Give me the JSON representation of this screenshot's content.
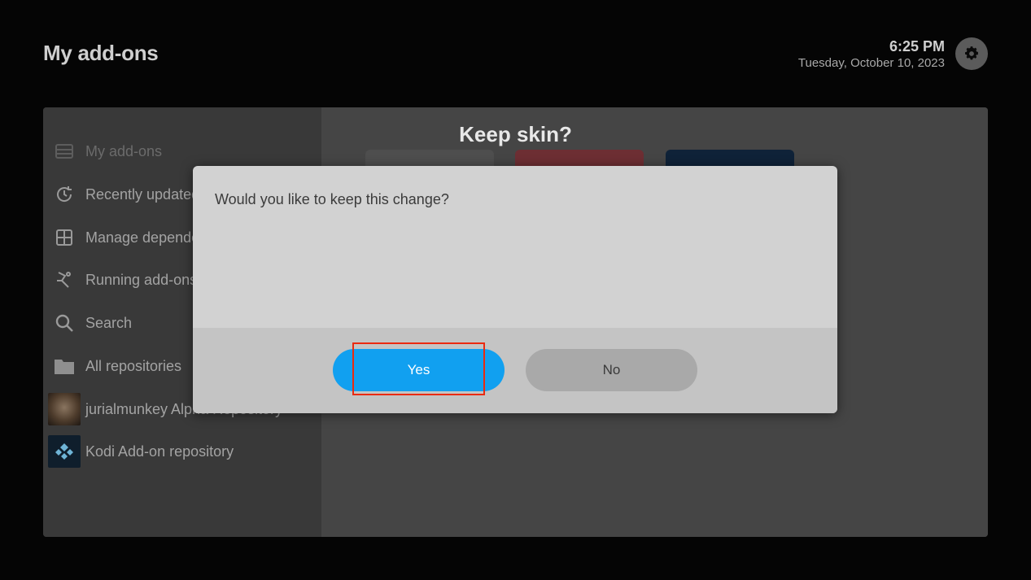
{
  "header": {
    "title": "My add-ons",
    "time": "6:25 PM",
    "date": "Tuesday, October 10, 2023",
    "settings_icon": "gear-icon"
  },
  "sidebar": {
    "items": [
      {
        "label": "My add-ons",
        "icon": "addon-box-icon"
      },
      {
        "label": "Recently updated",
        "icon": "refresh-clock-icon"
      },
      {
        "label": "Manage dependencies",
        "icon": "grid-box-icon"
      },
      {
        "label": "Running add-ons",
        "icon": "running-icon"
      },
      {
        "label": "Search",
        "icon": "search-icon"
      },
      {
        "label": "All repositories",
        "icon": "folder-icon"
      },
      {
        "label": "jurialmunkey Alpha Repository",
        "icon": "repository-thumbnail"
      },
      {
        "label": "Kodi Add-on repository",
        "icon": "kodi-logo"
      }
    ]
  },
  "dialog": {
    "title": "Keep skin?",
    "message": "Would you like to keep this change?",
    "yes_label": "Yes",
    "no_label": "No"
  },
  "colors": {
    "accent": "#11a0f0",
    "focus_highlight": "#ea2a10"
  }
}
